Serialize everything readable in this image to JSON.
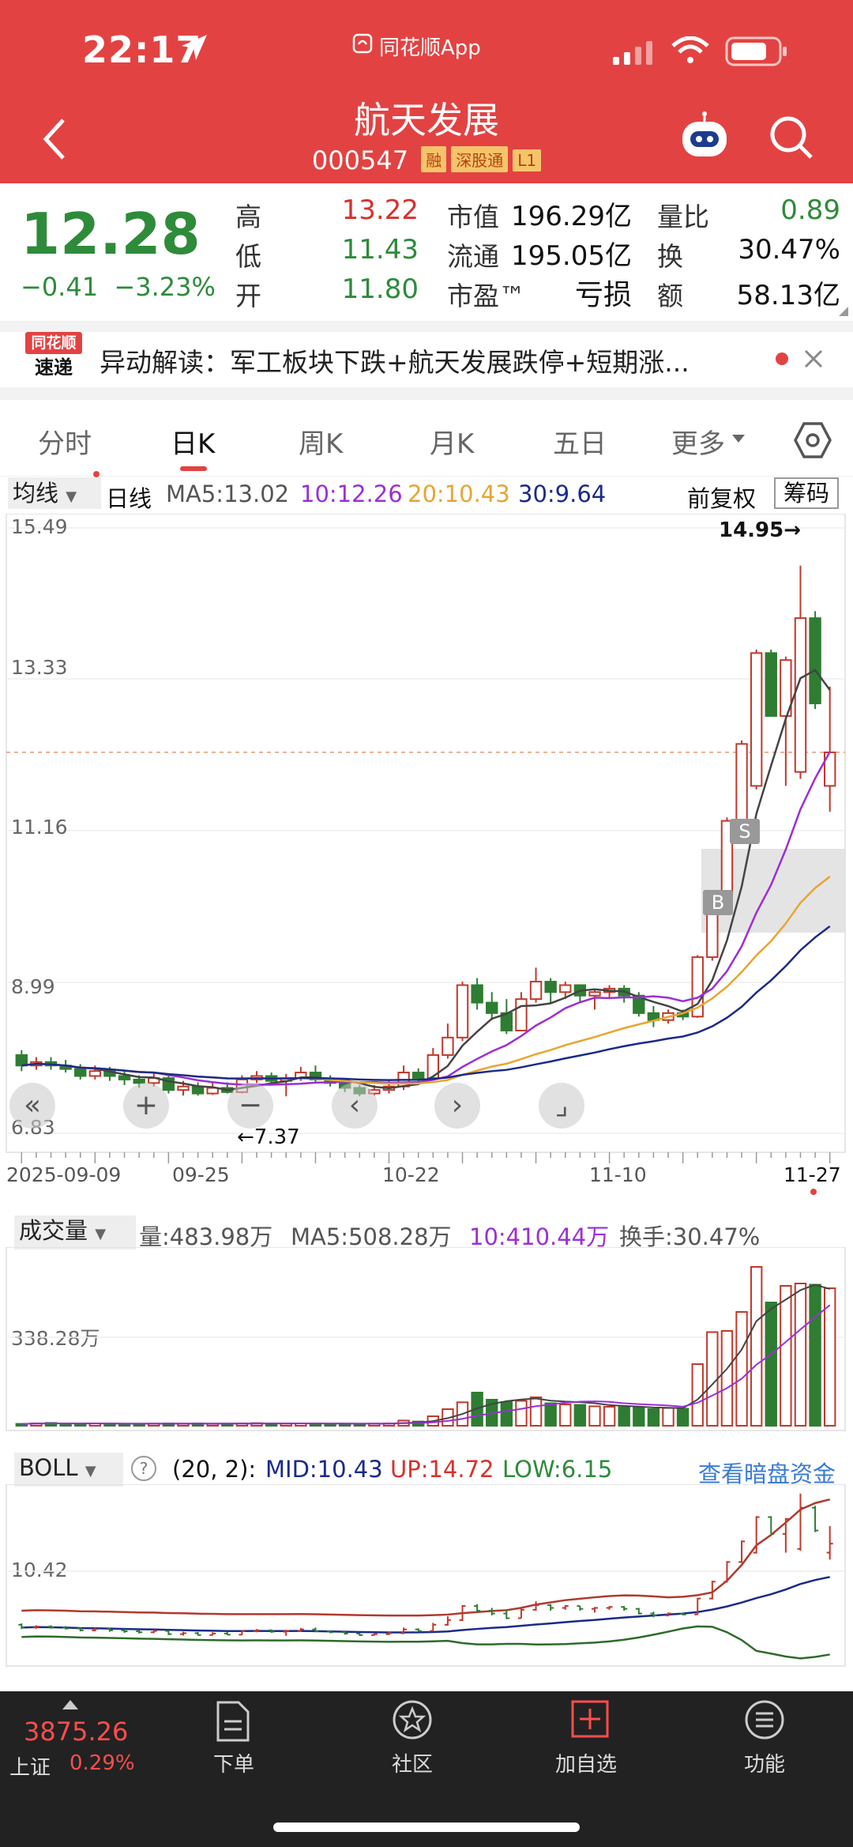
{
  "status": {
    "time": "22:17",
    "app_label": "同花顺App"
  },
  "stock": {
    "name": "航天发展",
    "code": "000547",
    "tags": [
      "融",
      "深股通",
      "L1"
    ],
    "price": "12.28",
    "change": "−0.41",
    "change_pct": "−3.23%"
  },
  "stats": {
    "high_label": "高",
    "high": "13.22",
    "low_label": "低",
    "low": "11.43",
    "open_label": "开",
    "open": "11.80",
    "mktcap_label": "市值",
    "mktcap": "196.29亿",
    "float_label": "流通",
    "float": "195.05亿",
    "pe_label": "市盈™",
    "pe": "亏损",
    "volratio_label": "量比",
    "volratio": "0.89",
    "turnover_label": "换",
    "turnover": "30.47%",
    "amount_label": "额",
    "amount": "58.13亿"
  },
  "news": {
    "logo_top": "同花顺",
    "logo_bottom": "速递",
    "label": "异动解读：",
    "text": "军工板块下跌+航天发展跌停+短期涨..."
  },
  "tabs": [
    "分时",
    "日K",
    "周K",
    "月K",
    "五日",
    "更多"
  ],
  "ma_bar": {
    "selector": "均线",
    "period": "日线",
    "ma5": "MA5:13.02",
    "ma10": "10:12.26",
    "ma20": "20:10.43",
    "ma30": "30:9.64",
    "adjust": "前复权",
    "chips": "筹码"
  },
  "kline": {
    "y_labels": [
      "15.49",
      "13.33",
      "11.16",
      "8.99",
      "6.83"
    ],
    "high_note": "14.95→",
    "low_note": "←7.37",
    "x_labels": [
      "2025-09-09",
      "09-25",
      "10-22",
      "11-10",
      "11-27"
    ],
    "markers": [
      "S",
      "B"
    ]
  },
  "volume": {
    "selector": "成交量",
    "vol": "量:483.98万",
    "ma5": "MA5:508.28万",
    "ma10": "10:410.44万",
    "turnover": "换手:30.47%",
    "y_label": "338.28万"
  },
  "boll": {
    "selector": "BOLL",
    "params": "(20, 2):",
    "mid": "MID:10.43",
    "up": "UP:14.72",
    "low": "LOW:6.15",
    "link": "查看暗盘资金",
    "y_label": "10.42"
  },
  "bottom": {
    "index_value": "3875.26",
    "index_name": "上证",
    "index_pct": "0.29%",
    "tabs": [
      "下单",
      "社区",
      "加自选",
      "功能"
    ]
  },
  "chart_data": {
    "type": "candlestick",
    "y_axis_ticks": [
      15.49,
      13.33,
      11.16,
      8.99,
      6.83
    ],
    "ylim": [
      6.83,
      15.49
    ],
    "x_ticks": [
      "2025-09-09",
      "09-25",
      "10-22",
      "11-10",
      "11-27"
    ],
    "candles": [
      {
        "o": 7.95,
        "c": 7.8,
        "h": 8.02,
        "l": 7.72
      },
      {
        "o": 7.8,
        "c": 7.85,
        "h": 7.92,
        "l": 7.74
      },
      {
        "o": 7.85,
        "c": 7.8,
        "h": 7.92,
        "l": 7.74
      },
      {
        "o": 7.8,
        "c": 7.75,
        "h": 7.88,
        "l": 7.7
      },
      {
        "o": 7.75,
        "c": 7.65,
        "h": 7.82,
        "l": 7.6
      },
      {
        "o": 7.65,
        "c": 7.72,
        "h": 7.8,
        "l": 7.6
      },
      {
        "o": 7.72,
        "c": 7.65,
        "h": 7.78,
        "l": 7.58
      },
      {
        "o": 7.65,
        "c": 7.6,
        "h": 7.72,
        "l": 7.52
      },
      {
        "o": 7.6,
        "c": 7.55,
        "h": 7.66,
        "l": 7.48
      },
      {
        "o": 7.55,
        "c": 7.62,
        "h": 7.7,
        "l": 7.5
      },
      {
        "o": 7.62,
        "c": 7.45,
        "h": 7.66,
        "l": 7.4
      },
      {
        "o": 7.45,
        "c": 7.5,
        "h": 7.58,
        "l": 7.37
      },
      {
        "o": 7.5,
        "c": 7.4,
        "h": 7.56,
        "l": 7.37
      },
      {
        "o": 7.4,
        "c": 7.48,
        "h": 7.55,
        "l": 7.38
      },
      {
        "o": 7.48,
        "c": 7.42,
        "h": 7.56,
        "l": 7.4
      },
      {
        "o": 7.42,
        "c": 7.6,
        "h": 7.66,
        "l": 7.4
      },
      {
        "o": 7.6,
        "c": 7.65,
        "h": 7.72,
        "l": 7.55
      },
      {
        "o": 7.65,
        "c": 7.58,
        "h": 7.7,
        "l": 7.52
      },
      {
        "o": 7.58,
        "c": 7.62,
        "h": 7.68,
        "l": 7.36
      },
      {
        "o": 7.62,
        "c": 7.7,
        "h": 7.78,
        "l": 7.58
      },
      {
        "o": 7.7,
        "c": 7.6,
        "h": 7.8,
        "l": 7.55
      },
      {
        "o": 7.6,
        "c": 7.55,
        "h": 7.66,
        "l": 7.5
      },
      {
        "o": 7.55,
        "c": 7.48,
        "h": 7.6,
        "l": 7.42
      },
      {
        "o": 7.48,
        "c": 7.4,
        "h": 7.52,
        "l": 7.36
      },
      {
        "o": 7.4,
        "c": 7.45,
        "h": 7.52,
        "l": 7.37
      },
      {
        "o": 7.45,
        "c": 7.5,
        "h": 7.58,
        "l": 7.4
      },
      {
        "o": 7.5,
        "c": 7.7,
        "h": 7.8,
        "l": 7.45
      },
      {
        "o": 7.7,
        "c": 7.62,
        "h": 7.76,
        "l": 7.55
      },
      {
        "o": 7.62,
        "c": 7.95,
        "h": 8.05,
        "l": 7.6
      },
      {
        "o": 7.95,
        "c": 8.2,
        "h": 8.4,
        "l": 7.9
      },
      {
        "o": 8.2,
        "c": 8.95,
        "h": 9.0,
        "l": 8.15
      },
      {
        "o": 8.95,
        "c": 8.7,
        "h": 9.05,
        "l": 8.6
      },
      {
        "o": 8.7,
        "c": 8.55,
        "h": 8.85,
        "l": 8.45
      },
      {
        "o": 8.55,
        "c": 8.3,
        "h": 8.75,
        "l": 8.25
      },
      {
        "o": 8.3,
        "c": 8.75,
        "h": 8.85,
        "l": 8.3
      },
      {
        "o": 8.75,
        "c": 9.0,
        "h": 9.2,
        "l": 8.7
      },
      {
        "o": 9.0,
        "c": 8.85,
        "h": 9.05,
        "l": 8.7
      },
      {
        "o": 8.85,
        "c": 8.95,
        "h": 9.0,
        "l": 8.75
      },
      {
        "o": 8.95,
        "c": 8.8,
        "h": 8.95,
        "l": 8.7
      },
      {
        "o": 8.8,
        "c": 8.85,
        "h": 8.9,
        "l": 8.6
      },
      {
        "o": 8.85,
        "c": 8.9,
        "h": 8.95,
        "l": 8.75
      },
      {
        "o": 8.9,
        "c": 8.8,
        "h": 8.95,
        "l": 8.7
      },
      {
        "o": 8.8,
        "c": 8.55,
        "h": 8.85,
        "l": 8.5
      },
      {
        "o": 8.55,
        "c": 8.45,
        "h": 8.65,
        "l": 8.35
      },
      {
        "o": 8.45,
        "c": 8.55,
        "h": 8.6,
        "l": 8.4
      },
      {
        "o": 8.55,
        "c": 8.5,
        "h": 8.6,
        "l": 8.45
      },
      {
        "o": 8.5,
        "c": 9.35,
        "h": 9.38,
        "l": 8.48
      },
      {
        "o": 9.35,
        "c": 10.25,
        "h": 10.3,
        "l": 9.3
      },
      {
        "o": 10.25,
        "c": 11.3,
        "h": 11.35,
        "l": 10.2
      },
      {
        "o": 11.3,
        "c": 12.4,
        "h": 12.45,
        "l": 11.25
      },
      {
        "o": 11.8,
        "c": 13.7,
        "h": 13.75,
        "l": 11.75
      },
      {
        "o": 13.7,
        "c": 12.8,
        "h": 13.75,
        "l": 12.8
      },
      {
        "o": 12.8,
        "c": 13.6,
        "h": 13.65,
        "l": 11.8
      },
      {
        "o": 12.0,
        "c": 14.2,
        "h": 14.95,
        "l": 11.9
      },
      {
        "o": 14.2,
        "c": 12.98,
        "h": 14.3,
        "l": 12.9
      },
      {
        "o": 11.8,
        "c": 12.28,
        "h": 13.22,
        "l": 11.43
      }
    ],
    "volumes": [
      0.08,
      0.1,
      0.12,
      0.09,
      0.08,
      0.1,
      0.09,
      0.08,
      0.08,
      0.09,
      0.1,
      0.09,
      0.1,
      0.08,
      0.09,
      0.1,
      0.11,
      0.1,
      0.09,
      0.1,
      0.09,
      0.08,
      0.09,
      0.08,
      0.09,
      0.1,
      0.22,
      0.18,
      0.4,
      0.7,
      0.99,
      1.4,
      1.1,
      1.0,
      1.05,
      1.2,
      0.95,
      0.9,
      0.88,
      0.82,
      0.8,
      0.78,
      0.76,
      0.7,
      0.75,
      0.72,
      2.6,
      3.95,
      4.0,
      4.8,
      6.7,
      5.2,
      5.9,
      6.0,
      5.95,
      5.8
    ],
    "volume_ylabel": "338.28万",
    "boll_labels": {
      "mid": 10.43,
      "up": 14.72,
      "low": 6.15
    }
  }
}
